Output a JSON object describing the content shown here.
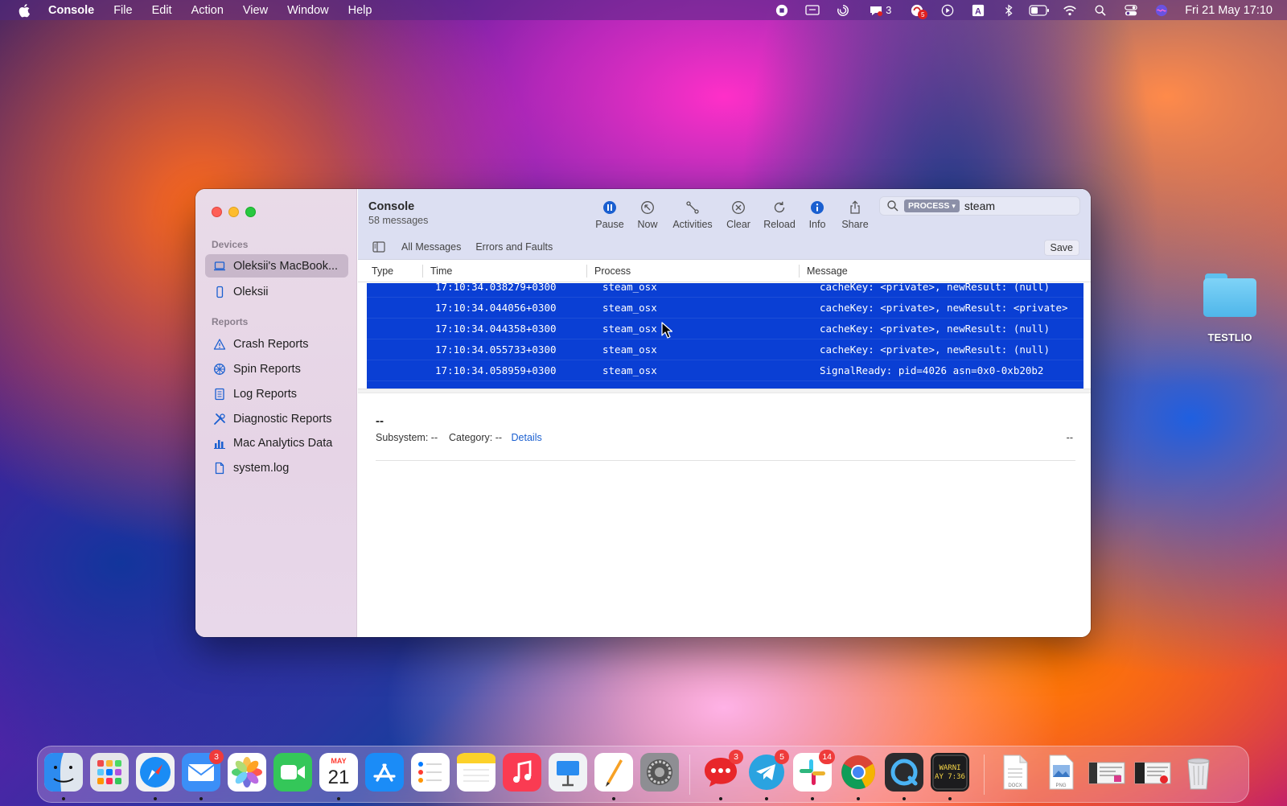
{
  "menubar": {
    "app_name": "Console",
    "menus": [
      "File",
      "Edit",
      "Action",
      "View",
      "Window",
      "Help"
    ],
    "chat_count": "3",
    "notif_badge": "5",
    "datetime": "Fri 21 May  17:10"
  },
  "desktop": {
    "folder_label": "TESTLIO"
  },
  "sidebar": {
    "devices_header": "Devices",
    "devices": [
      {
        "label": "Oleksii's MacBook...",
        "icon": "laptop-icon"
      },
      {
        "label": "Oleksii",
        "icon": "phone-icon"
      }
    ],
    "reports_header": "Reports",
    "reports": [
      {
        "label": "Crash Reports",
        "icon": "warning-triangle-icon"
      },
      {
        "label": "Spin Reports",
        "icon": "spinner-icon"
      },
      {
        "label": "Log Reports",
        "icon": "document-list-icon"
      },
      {
        "label": "Diagnostic Reports",
        "icon": "tools-icon"
      },
      {
        "label": "Mac Analytics Data",
        "icon": "bar-chart-icon"
      },
      {
        "label": "system.log",
        "icon": "document-icon"
      }
    ]
  },
  "toolbar": {
    "title": "Console",
    "subtitle": "58 messages",
    "buttons": [
      {
        "label": "Pause",
        "icon": "pause-icon"
      },
      {
        "label": "Now",
        "icon": "now-icon"
      },
      {
        "label": "Activities",
        "icon": "activities-icon"
      },
      {
        "label": "Clear",
        "icon": "clear-icon"
      },
      {
        "label": "Reload",
        "icon": "reload-icon"
      },
      {
        "label": "Info",
        "icon": "info-icon"
      },
      {
        "label": "Share",
        "icon": "share-icon"
      }
    ],
    "search": {
      "token": "PROCESS",
      "value": "steam"
    }
  },
  "filterbar": {
    "tabs": [
      "All Messages",
      "Errors and Faults"
    ],
    "save_label": "Save"
  },
  "table": {
    "columns": [
      "Type",
      "Time",
      "Process",
      "Message"
    ],
    "rows": [
      {
        "time": "17:10:34.038279+0300",
        "process": "steam_osx",
        "message": "cacheKey: <private>, newResult: (null)"
      },
      {
        "time": "17:10:34.044056+0300",
        "process": "steam_osx",
        "message": "cacheKey: <private>, newResult: <private>"
      },
      {
        "time": "17:10:34.044358+0300",
        "process": "steam_osx",
        "message": "cacheKey: <private>, newResult: (null)"
      },
      {
        "time": "17:10:34.055733+0300",
        "process": "steam_osx",
        "message": "cacheKey: <private>, newResult: (null)"
      },
      {
        "time": "17:10:34.058959+0300",
        "process": "steam_osx",
        "message": "SignalReady: pid=4026 asn=0x0-0xb20b2"
      }
    ]
  },
  "detail": {
    "heading": "--",
    "subsystem_label": "Subsystem:",
    "subsystem_value": "--",
    "category_label": "Category:",
    "category_value": "--",
    "details_link": "Details",
    "right_value": "--"
  },
  "dock": {
    "apps": [
      {
        "name": "Finder",
        "icon": "finder-icon"
      },
      {
        "name": "Launchpad",
        "icon": "launchpad-icon"
      },
      {
        "name": "Safari",
        "icon": "safari-icon"
      },
      {
        "name": "Mail",
        "icon": "mail-icon",
        "badge": "3"
      },
      {
        "name": "Photos",
        "icon": "photos-icon"
      },
      {
        "name": "FaceTime",
        "icon": "facetime-icon"
      },
      {
        "name": "Calendar",
        "icon": "calendar-icon",
        "month": "MAY",
        "day": "21"
      },
      {
        "name": "App Store",
        "icon": "appstore-icon"
      },
      {
        "name": "Reminders",
        "icon": "reminders-icon"
      },
      {
        "name": "Notes",
        "icon": "notes-icon"
      },
      {
        "name": "Music",
        "icon": "music-icon"
      },
      {
        "name": "Keynote",
        "icon": "keynote-icon"
      },
      {
        "name": "Pages",
        "icon": "pages-icon"
      },
      {
        "name": "System Preferences",
        "icon": "system-preferences-icon"
      },
      {
        "name": "Speeko",
        "icon": "chat-bubble-icon",
        "badge": "3"
      },
      {
        "name": "Telegram",
        "icon": "telegram-icon",
        "badge": "5"
      },
      {
        "name": "Slack",
        "icon": "slack-icon",
        "badge": "14"
      },
      {
        "name": "Chrome",
        "icon": "chrome-icon"
      },
      {
        "name": "QuickTime",
        "icon": "quicktime-icon"
      },
      {
        "name": "Console",
        "icon": "console-icon",
        "text": "WARNI\nAY 7:36"
      },
      {
        "name": "Document",
        "icon": "docx-file-icon"
      },
      {
        "name": "Image",
        "icon": "png-file-icon"
      },
      {
        "name": "Screenshot 1",
        "icon": "screenshot-thumb-icon"
      },
      {
        "name": "Screenshot 2",
        "icon": "screenshot-thumb-icon"
      },
      {
        "name": "Trash",
        "icon": "trash-icon"
      }
    ]
  }
}
